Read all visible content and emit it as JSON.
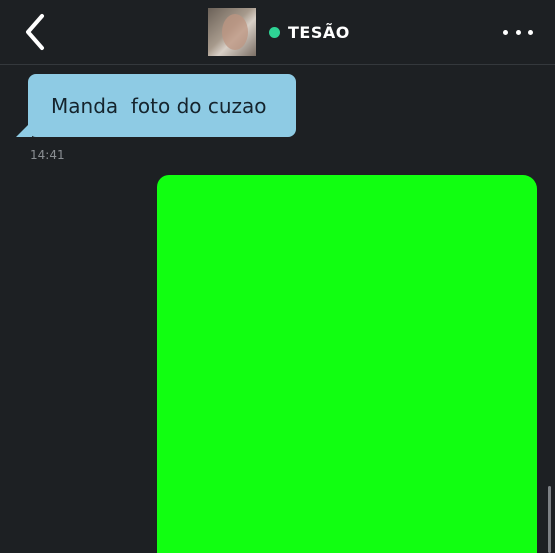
{
  "header": {
    "contact_name": "TESÃO",
    "status": "online",
    "status_color": "#2ed394",
    "back_icon": "chevron-left-icon",
    "more_icon": "more-horizontal-icon"
  },
  "messages": [
    {
      "direction": "incoming",
      "type": "text",
      "text": "Manda  foto do cuzao",
      "time": "14:41",
      "bubble_color": "#8ecbe4"
    },
    {
      "direction": "outgoing",
      "type": "image",
      "image_color": "#11ff11"
    }
  ],
  "theme": {
    "background": "#1d2023"
  }
}
